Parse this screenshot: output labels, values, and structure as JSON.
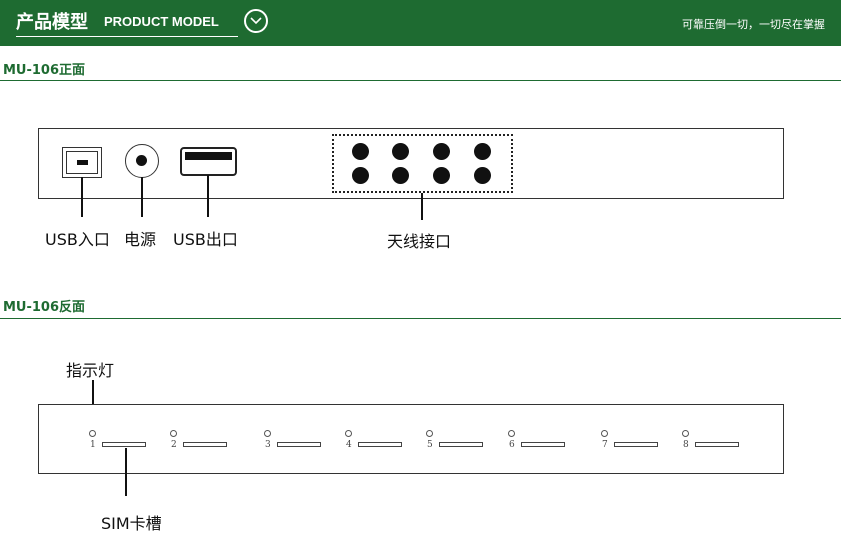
{
  "header": {
    "title_cn": "产品模型",
    "title_en": "PRODUCT MODEL",
    "slogan": "可靠压倒一切，一切尽在掌握",
    "accent_color": "#1e6b31",
    "dropdown_icon": "chevron-down-icon"
  },
  "front": {
    "title": "MU-106正面",
    "labels": {
      "usb_in": "USB入口",
      "power": "电源",
      "usb_out": "USB出口",
      "antenna": "天线接口"
    }
  },
  "back": {
    "title": "MU-106反面",
    "labels": {
      "indicator": "指示灯",
      "sim_slot": "SIM卡槽"
    },
    "slots": [
      "1",
      "2",
      "3",
      "4",
      "5",
      "6",
      "7",
      "8"
    ]
  }
}
